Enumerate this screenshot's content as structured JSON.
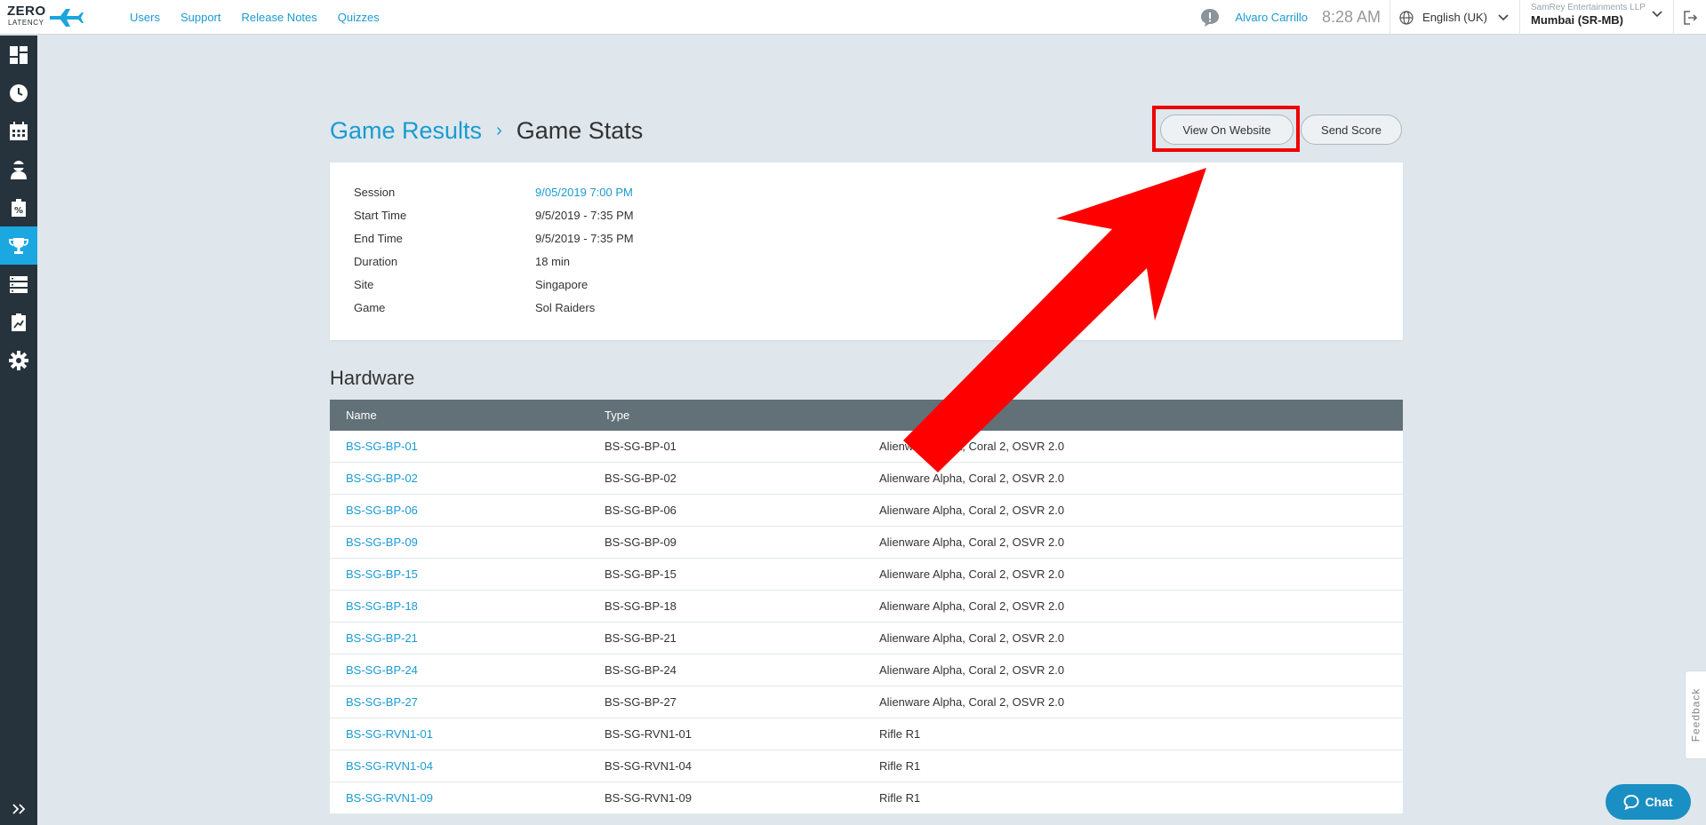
{
  "logo": {
    "line1": "ZERO",
    "line2": "LATENCY"
  },
  "topnav": [
    "Users",
    "Support",
    "Release Notes",
    "Quizzes"
  ],
  "header": {
    "user_name": "Alvaro Carrillo",
    "time": "8:28 AM",
    "language": "English (UK)",
    "company": "SamRey Entertainments LLP",
    "location": "Mumbai (SR-MB)"
  },
  "sidebar": {
    "icons": [
      "dashboard-icon",
      "clock-icon",
      "calendar-icon",
      "user-vr-icon",
      "voucher-icon",
      "trophy-icon",
      "server-icon",
      "report-icon",
      "gear-icon"
    ],
    "active_index": 5
  },
  "breadcrumb": {
    "parent": "Game Results",
    "separator": "›",
    "current": "Game Stats"
  },
  "actions": {
    "view_website": "View On Website",
    "send_score": "Send Score"
  },
  "session": {
    "rows": [
      {
        "label": "Session",
        "value": "9/05/2019 7:00 PM",
        "link": true
      },
      {
        "label": "Start Time",
        "value": "9/5/2019 - 7:35 PM",
        "link": false
      },
      {
        "label": "End Time",
        "value": "9/5/2019 - 7:35 PM",
        "link": false
      },
      {
        "label": "Duration",
        "value": "18 min",
        "link": false
      },
      {
        "label": "Site",
        "value": "Singapore",
        "link": false
      },
      {
        "label": "Game",
        "value": "Sol Raiders",
        "link": false
      }
    ]
  },
  "hardware": {
    "title": "Hardware",
    "columns": [
      "Name",
      "Type",
      ""
    ],
    "rows": [
      [
        "BS-SG-BP-01",
        "BS-SG-BP-01",
        "Alienware Alpha, Coral 2, OSVR 2.0"
      ],
      [
        "BS-SG-BP-02",
        "BS-SG-BP-02",
        "Alienware Alpha, Coral 2, OSVR 2.0"
      ],
      [
        "BS-SG-BP-06",
        "BS-SG-BP-06",
        "Alienware Alpha, Coral 2, OSVR 2.0"
      ],
      [
        "BS-SG-BP-09",
        "BS-SG-BP-09",
        "Alienware Alpha, Coral 2, OSVR 2.0"
      ],
      [
        "BS-SG-BP-15",
        "BS-SG-BP-15",
        "Alienware Alpha, Coral 2, OSVR 2.0"
      ],
      [
        "BS-SG-BP-18",
        "BS-SG-BP-18",
        "Alienware Alpha, Coral 2, OSVR 2.0"
      ],
      [
        "BS-SG-BP-21",
        "BS-SG-BP-21",
        "Alienware Alpha, Coral 2, OSVR 2.0"
      ],
      [
        "BS-SG-BP-24",
        "BS-SG-BP-24",
        "Alienware Alpha, Coral 2, OSVR 2.0"
      ],
      [
        "BS-SG-BP-27",
        "BS-SG-BP-27",
        "Alienware Alpha, Coral 2, OSVR 2.0"
      ],
      [
        "BS-SG-RVN1-01",
        "BS-SG-RVN1-01",
        "Rifle R1"
      ],
      [
        "BS-SG-RVN1-04",
        "BS-SG-RVN1-04",
        "Rifle R1"
      ],
      [
        "BS-SG-RVN1-09",
        "BS-SG-RVN1-09",
        "Rifle R1"
      ]
    ]
  },
  "widgets": {
    "feedback": "Feedback",
    "chat": "Chat"
  },
  "colors": {
    "accent": "#1a9bd1",
    "sidebar": "#26333c",
    "annotation": "#ee0000",
    "table_header": "#627078"
  }
}
